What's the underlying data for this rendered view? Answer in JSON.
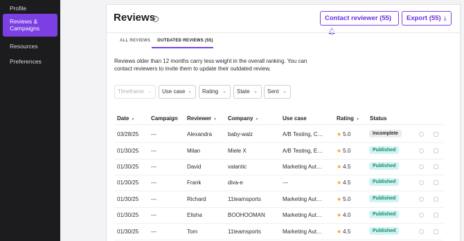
{
  "sidebar": {
    "items": [
      {
        "label": "Profile"
      },
      {
        "label": "Reviews & Campaigns",
        "active": true
      },
      {
        "label": "Resources"
      },
      {
        "label": "Preferences"
      }
    ]
  },
  "header": {
    "title": "Reviews",
    "help_icon": "?",
    "contact_label": "Contact reviewer (55)",
    "contact_icon": "bell-icon",
    "export_label": "Export (55)",
    "export_icon": "download-icon"
  },
  "tabs": [
    {
      "label": "ALL REVIEWS"
    },
    {
      "label": "OUTDATED REVIEWS (55)",
      "active": true
    }
  ],
  "info_text": "Reviews older than 12 months carry less weight in the overall ranking. You can contact reviewers to invite them to update their outdated review.",
  "filters": [
    {
      "label": "Timeframe",
      "disabled": true
    },
    {
      "label": "Use case"
    },
    {
      "label": "Rating"
    },
    {
      "label": "State"
    },
    {
      "label": "Sent"
    }
  ],
  "table": {
    "columns": [
      "Date",
      "Campaign",
      "Reviewer",
      "Company",
      "Use case",
      "Rating",
      "Status"
    ],
    "rows": [
      {
        "date": "03/28/25",
        "campaign": "---",
        "reviewer": "Alexandra",
        "company": "baby-walz",
        "use_case": "A/B Testing, Cu...",
        "rating": "5.0",
        "status": "Incomplete"
      },
      {
        "date": "01/30/25",
        "campaign": "---",
        "reviewer": "Milan",
        "company": "Miele X",
        "use_case": "A/B Testing, Em...",
        "rating": "5.0",
        "status": "Published"
      },
      {
        "date": "01/30/25",
        "campaign": "---",
        "reviewer": "David",
        "company": "valantic",
        "use_case": "Marketing Auto...",
        "rating": "4.5",
        "status": "Published"
      },
      {
        "date": "01/30/25",
        "campaign": "---",
        "reviewer": "Frank",
        "company": "diva-e",
        "use_case": "---",
        "rating": "4.5",
        "status": "Published"
      },
      {
        "date": "01/30/25",
        "campaign": "---",
        "reviewer": "Richard",
        "company": "11teamsports",
        "use_case": "Marketing Auto...",
        "rating": "5.0",
        "status": "Published"
      },
      {
        "date": "01/30/25",
        "campaign": "---",
        "reviewer": "Elisha",
        "company": "BOOHOOMAN",
        "use_case": "Marketing Auto...",
        "rating": "4.0",
        "status": "Published"
      },
      {
        "date": "01/30/25",
        "campaign": "---",
        "reviewer": "Tom",
        "company": "11teamsports",
        "use_case": "Marketing Auto...",
        "rating": "4.5",
        "status": "Published"
      }
    ]
  },
  "colors": {
    "accent": "#7b3fe4",
    "sidebar_bg": "#1c1c1f",
    "published_bg": "#d3f3ef",
    "published_text": "#0f8a78",
    "star": "#f2a618"
  }
}
